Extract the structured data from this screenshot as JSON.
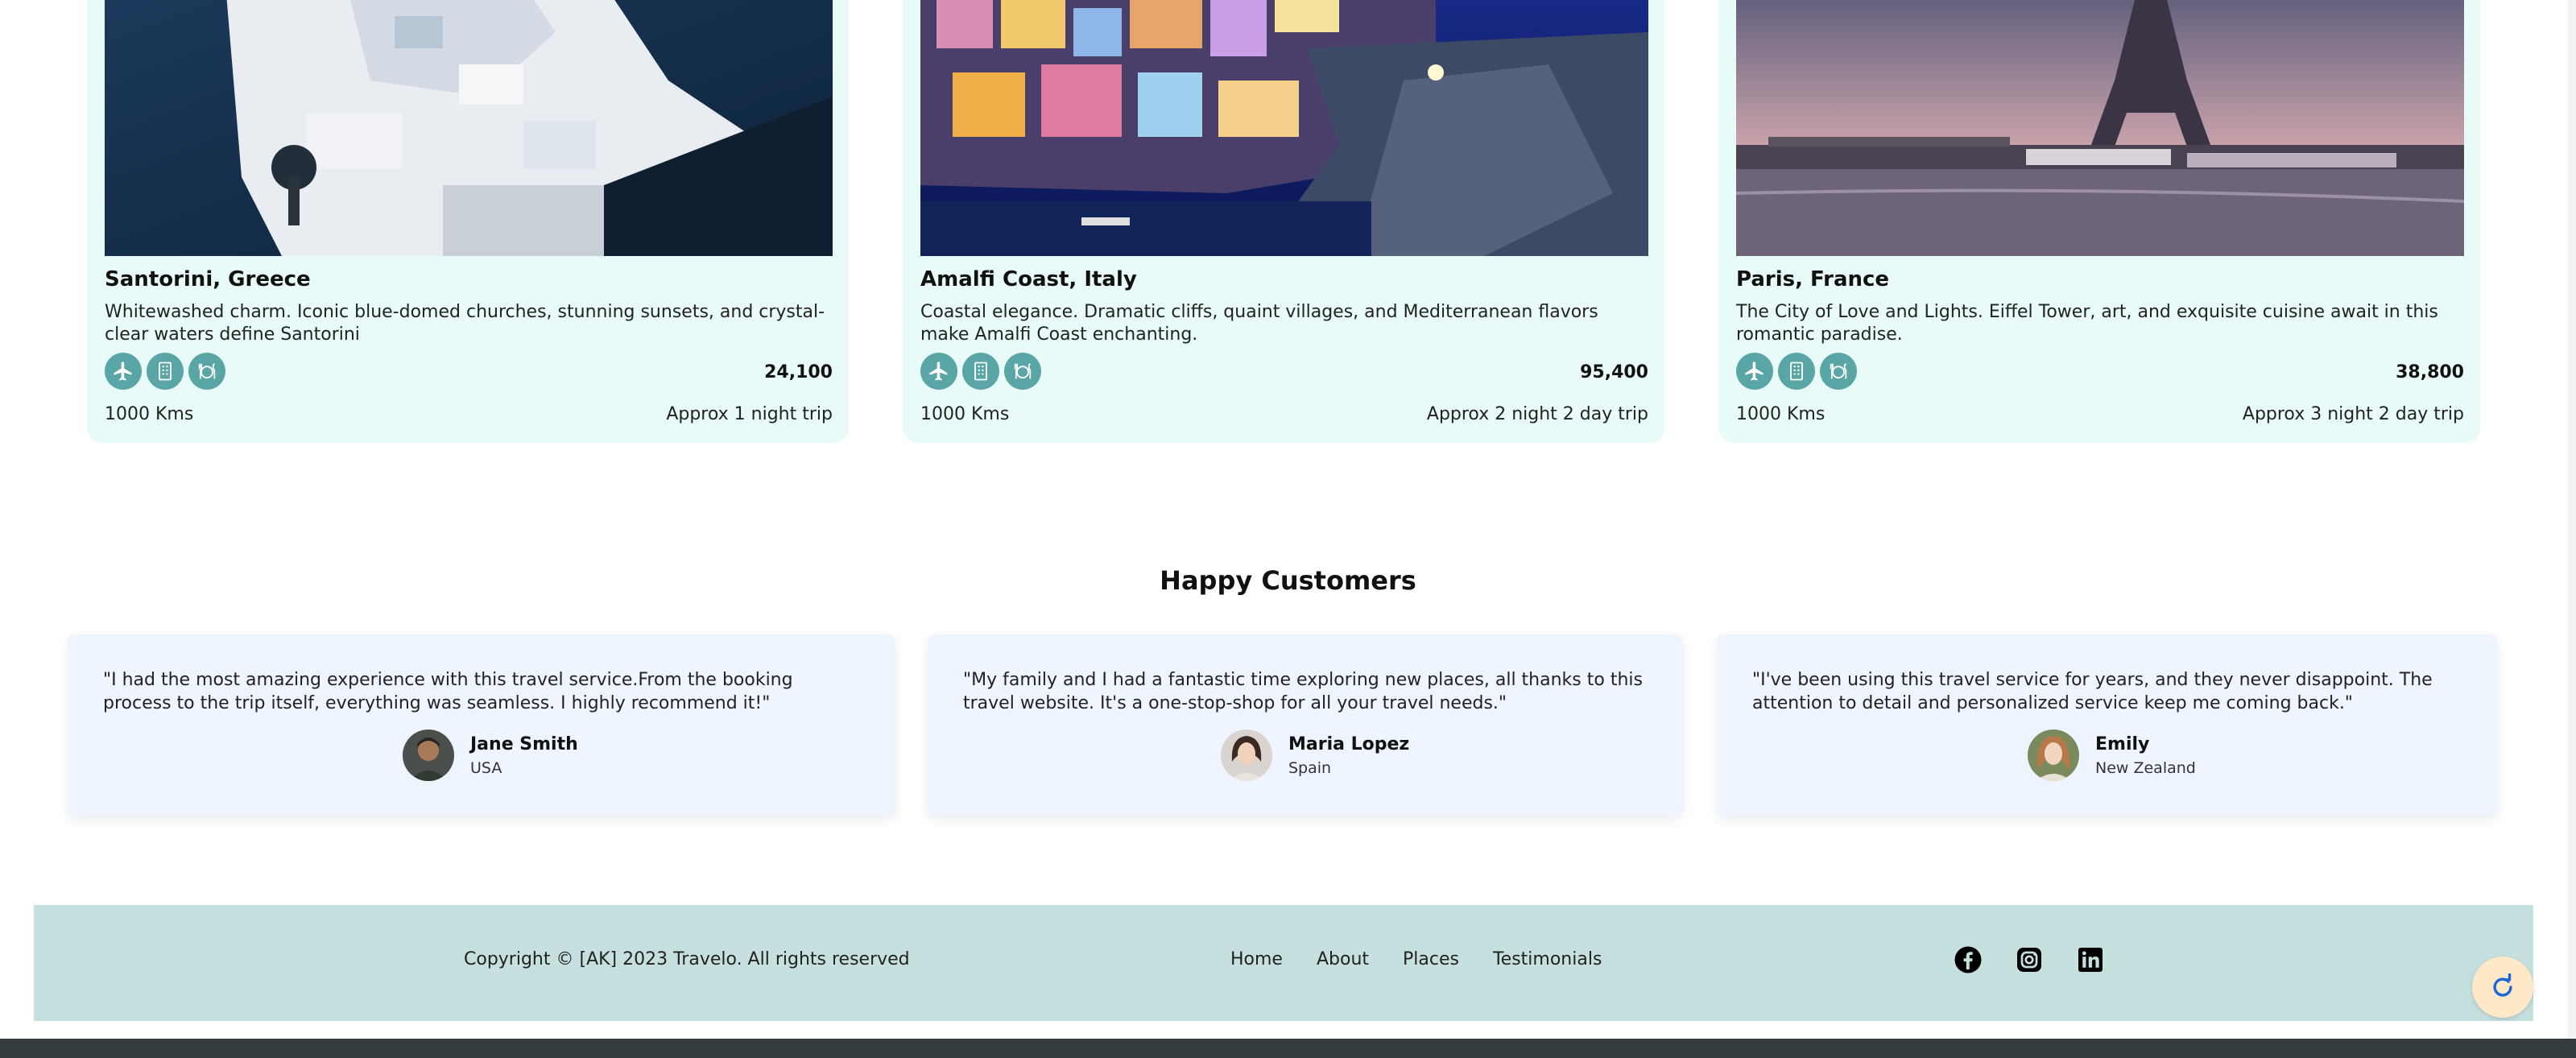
{
  "places": [
    {
      "name": "Santorini, Greece",
      "description": "Whitewashed charm. Iconic blue-domed churches, stunning sunsets, and crystal-clear waters define Santorini",
      "price": "24,100",
      "distance": "1000 Kms",
      "trip": "Approx 1 night trip",
      "photo": "santorini-photo",
      "amenity_icons": [
        "plane-icon",
        "hotel-icon",
        "dining-icon"
      ]
    },
    {
      "name": "Amalfi Coast, Italy",
      "description": "Coastal elegance. Dramatic cliffs, quaint villages, and Mediterranean flavors make Amalfi Coast enchanting.",
      "price": "95,400",
      "distance": "1000 Kms",
      "trip": "Approx 2 night 2 day trip",
      "photo": "amalfi-photo",
      "amenity_icons": [
        "plane-icon",
        "hotel-icon",
        "dining-icon"
      ]
    },
    {
      "name": "Paris, France",
      "description": "The City of Love and Lights. Eiffel Tower, art, and exquisite cuisine await in this romantic paradise.",
      "price": "38,800",
      "distance": "1000 Kms",
      "trip": "Approx 3 night 2 day trip",
      "photo": "paris-photo",
      "amenity_icons": [
        "plane-icon",
        "hotel-icon",
        "dining-icon"
      ]
    }
  ],
  "testimonials": {
    "title": "Happy Customers",
    "items": [
      {
        "quote": "\"I had the most amazing experience with this travel service.From the booking process to the trip itself, everything was seamless. I highly recommend it!\"",
        "name": "Jane Smith",
        "country": "USA"
      },
      {
        "quote": "\"My family and I had a fantastic time exploring new places, all thanks to this travel website. It's a one-stop-shop for all your travel needs.\"",
        "name": "Maria Lopez",
        "country": "Spain"
      },
      {
        "quote": "\"I've been using this travel service for years, and they never disappoint. The attention to detail and personalized service keep me coming back.\"",
        "name": "Emily",
        "country": "New Zealand"
      }
    ]
  },
  "footer": {
    "copyright": "Copyright © [AK] 2023 Travelo. All rights reserved",
    "nav": [
      "Home",
      "About",
      "Places",
      "Testimonials"
    ],
    "social_icons": [
      "facebook-icon",
      "instagram-icon",
      "linkedin-icon"
    ]
  },
  "colors": {
    "card_bg": "#e8fbf9",
    "icon_teal": "#5aa6a6",
    "testimonial_bg": "#eef5ff",
    "footer_bg": "#c6e0e0",
    "scroll_button_bg": "#fde9c8"
  }
}
